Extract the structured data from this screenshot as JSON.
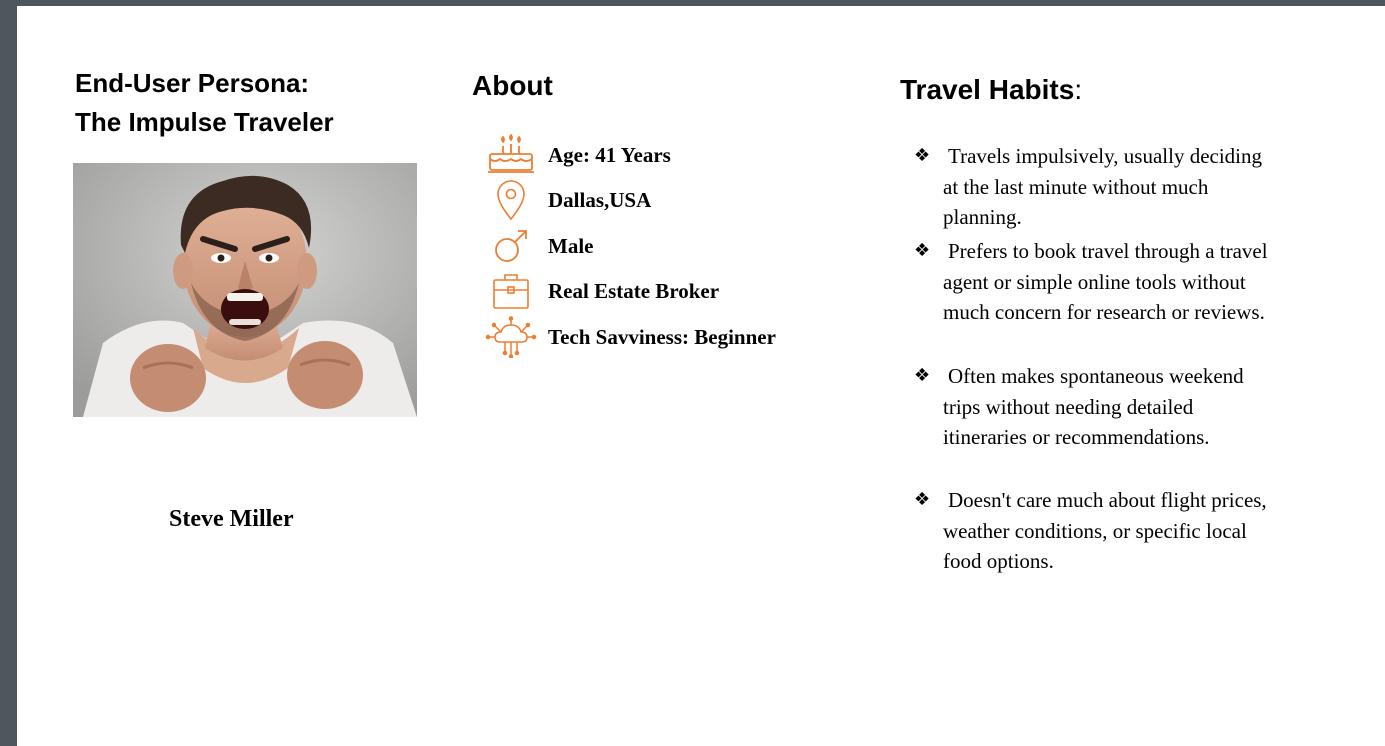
{
  "persona": {
    "title_line1": "End-User Persona:",
    "title_line2": "The Impulse Traveler",
    "name": "Steve Miller",
    "photo_label": "angry-man-photo"
  },
  "about": {
    "heading": "About",
    "items": [
      {
        "icon": "birthday-cake-icon",
        "text": "Age: 41 Years"
      },
      {
        "icon": "location-pin-icon",
        "text": "Dallas,USA"
      },
      {
        "icon": "male-symbol-icon",
        "text": "Male"
      },
      {
        "icon": "briefcase-icon",
        "text": "Real Estate Broker"
      },
      {
        "icon": "cloud-network-icon",
        "text": "Tech Savviness: Beginner"
      }
    ]
  },
  "habits": {
    "heading": "Travel Habits",
    "heading_suffix": ":",
    "bullet": "❖",
    "items": [
      "Travels impulsively, usually deciding at the last minute without much planning.",
      "Prefers to book travel through a travel agent or simple online tools without much concern for research or reviews.",
      "Often makes spontaneous weekend trips without needing detailed itineraries or recommendations.",
      "Doesn't care much about flight prices, weather conditions, or specific local food options."
    ]
  },
  "colors": {
    "icon_accent": "#ed7d31",
    "page_background": "#ffffff",
    "window_background": "#4f575e"
  }
}
